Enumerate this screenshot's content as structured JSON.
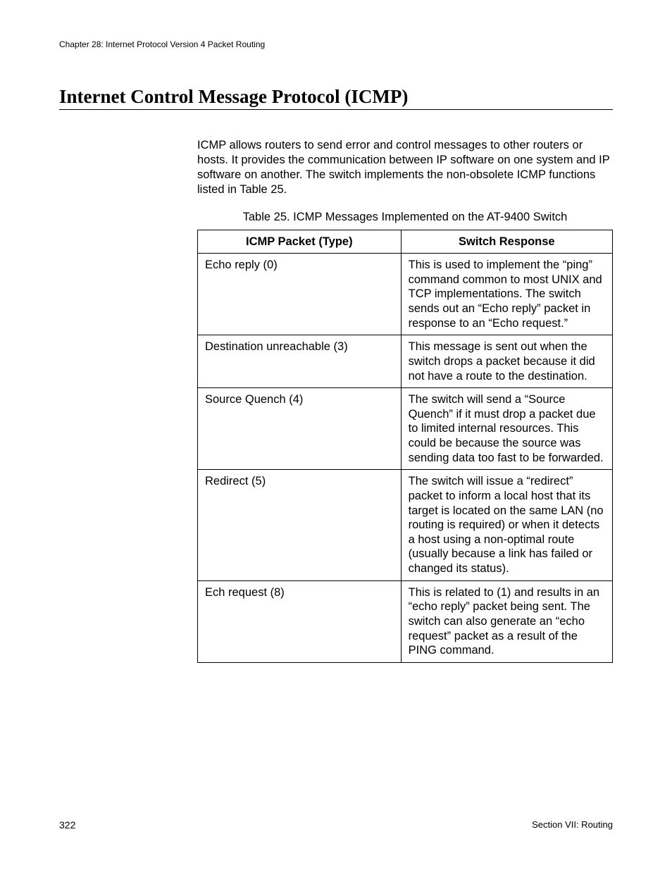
{
  "header": {
    "chapter": "Chapter 28: Internet Protocol Version 4 Packet Routing"
  },
  "section": {
    "title": "Internet Control Message Protocol (ICMP)"
  },
  "body": {
    "intro": "ICMP allows routers to send error and control messages to other routers or hosts. It provides the communication between IP software on one system and IP software on another. The switch implements the non-obsolete ICMP functions listed in Table 25.",
    "table_caption": "Table 25. ICMP Messages Implemented on the AT-9400 Switch",
    "table_headers": {
      "col1": "ICMP Packet (Type)",
      "col2": "Switch Response"
    },
    "rows": [
      {
        "type": "Echo reply (0)",
        "resp": "This is used to implement the “ping” command common to most UNIX and TCP implementations. The switch sends out an “Echo reply” packet in response to an “Echo request.”"
      },
      {
        "type": "Destination unreachable (3)",
        "resp": "This message is sent out when the switch drops a packet because it did not have a route to the destination."
      },
      {
        "type": "Source Quench (4)",
        "resp": "The switch will send a “Source Quench” if it must drop a packet due to limited internal resources. This could be because the source was sending data too fast to be forwarded."
      },
      {
        "type": "Redirect (5)",
        "resp": "The switch will issue a “redirect” packet to inform a local host that its target is located on the same LAN (no routing is required) or when it detects a host using a non-optimal route (usually because a link has failed or changed its status)."
      },
      {
        "type": "Ech request (8)",
        "resp": "This is related to (1) and results in an “echo reply” packet being sent. The switch can also generate an “echo request” packet as a result of the PING command."
      }
    ]
  },
  "footer": {
    "page_number": "322",
    "section_label": "Section VII: Routing"
  }
}
